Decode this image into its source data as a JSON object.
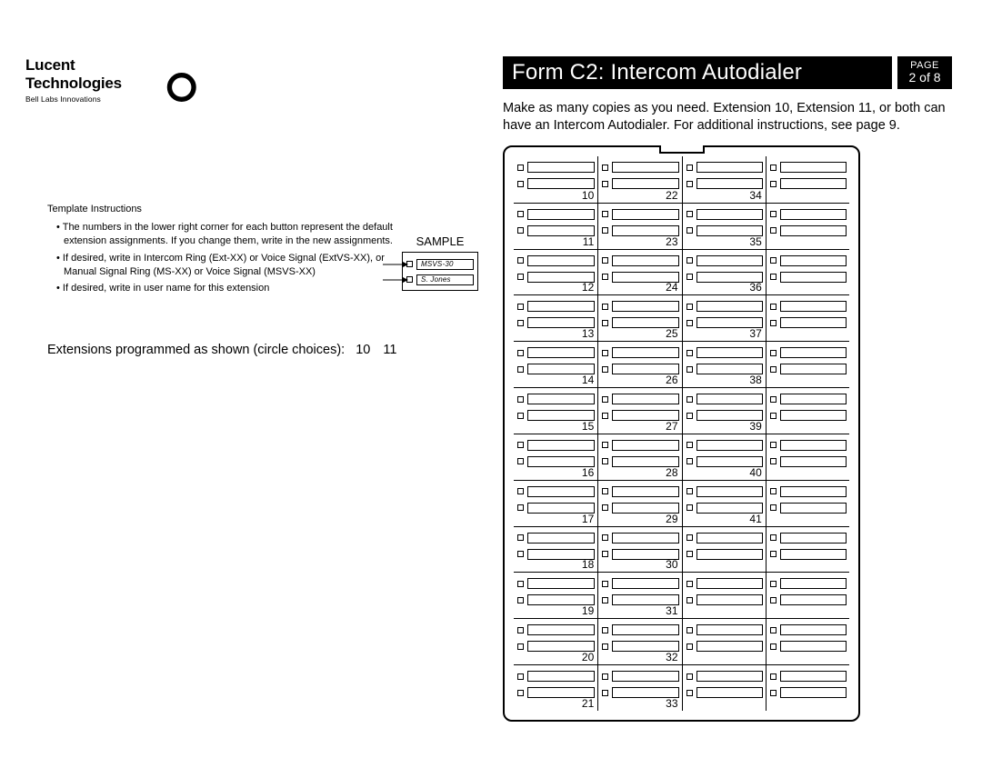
{
  "logo": {
    "company": "Lucent Technologies",
    "tagline": "Bell Labs Innovations"
  },
  "title": {
    "main": "Form C2:  Intercom Autodialer",
    "page_label": "PAGE",
    "page_num": "2 of 8"
  },
  "intro": "Make as many copies as you need. Extension 10, Extension 11, or both can have an Intercom Autodialer. For additional instructions, see page 9.",
  "instructions": {
    "heading": "Template Instructions",
    "items": [
      "The numbers in the lower right corner for each button represent the default extension assignments. If you change them, write in the new assignments.",
      "If desired, write in Intercom Ring (Ext-XX) or Voice Signal (ExtVS-XX), or Manual Signal Ring (MS-XX) or Voice Signal (MSVS-XX)",
      "If desired, write in user name for this extension"
    ]
  },
  "sample": {
    "label": "SAMPLE",
    "top_text": "MSVS-30",
    "bottom_text": "S. Jones"
  },
  "ext_programmed": {
    "label": "Extensions programmed as shown (circle choices):",
    "choices": [
      "10",
      "11"
    ]
  },
  "grid_columns": [
    [
      "10",
      "11",
      "12",
      "13",
      "14",
      "15",
      "16",
      "17",
      "18",
      "19",
      "20",
      "21"
    ],
    [
      "22",
      "23",
      "24",
      "25",
      "26",
      "27",
      "28",
      "29",
      "30",
      "31",
      "32",
      "33"
    ],
    [
      "34",
      "35",
      "36",
      "37",
      "38",
      "39",
      "40",
      "41",
      "",
      "",
      "",
      ""
    ],
    [
      "",
      "",
      "",
      "",
      "",
      "",
      "",
      "",
      "",
      "",
      "",
      ""
    ]
  ]
}
